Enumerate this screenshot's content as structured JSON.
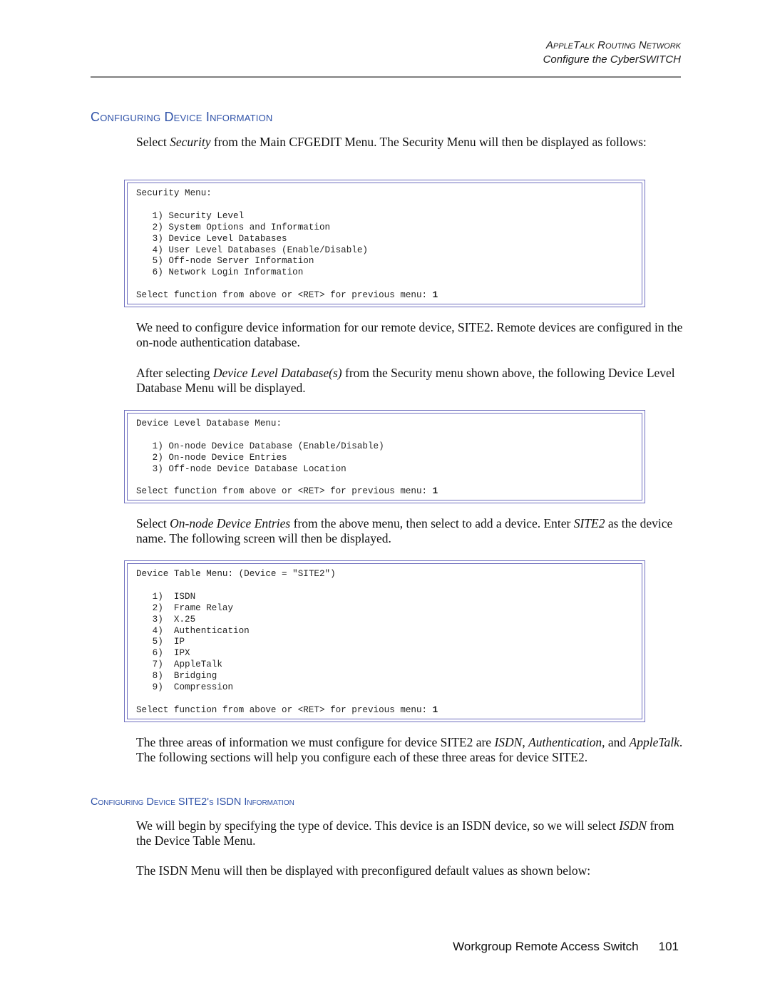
{
  "header": {
    "chapter": "AppleTalk Routing Network",
    "section": "Configure the CyberSWITCH"
  },
  "section_heading": "Configuring Device Information",
  "paragraphs": {
    "p1_pre": "Select ",
    "p1_em": "Security",
    "p1_post": " from the Main CFGEDIT Menu. The Security Menu will then be displayed as follows:",
    "p2": "We need to configure device information for our remote device, SITE2. Remote devices are configured in the on-node authentication database.",
    "p3_pre": "After selecting ",
    "p3_em": "Device Level Database(s)",
    "p3_post": " from the Security menu shown above, the following Device Level Database Menu will be displayed.",
    "p4_pre": "Select ",
    "p4_em1": "On-node Device Entries",
    "p4_mid": " from the above menu, then select to add a device. Enter ",
    "p4_em2": "SITE2",
    "p4_post": " as the device name. The following screen will then be displayed.",
    "p5_pre": "The three areas of information we must configure for device SITE2 are ",
    "p5_em1": "ISDN",
    "p5_sep1": ", ",
    "p5_em2": "Authentication",
    "p5_sep2": ", and ",
    "p5_em3": "AppleTalk",
    "p5_post": ". The following sections will help you configure each of these three areas for device SITE2.",
    "p6_pre": "We will begin by specifying the type of device. This device is an ISDN device, so we will select ",
    "p6_em": "ISDN",
    "p6_post": " from the Device Table Menu.",
    "p7": "The ISDN Menu will then be displayed with preconfigured default values as shown below:"
  },
  "subsection_heading": "Configuring Device SITE2's ISDN Information",
  "screens": {
    "security": {
      "title": "Security Menu:",
      "items": [
        "   1) Security Level",
        "   2) System Options and Information",
        "   3) Device Level Databases",
        "   4) User Level Databases (Enable/Disable)",
        "   5) Off-node Server Information",
        "   6) Network Login Information"
      ],
      "prompt": "Select function from above or <RET> for previous menu: ",
      "input": "1"
    },
    "device_level": {
      "title": "Device Level Database Menu:",
      "items": [
        "   1) On-node Device Database (Enable/Disable)",
        "   2) On-node Device Entries",
        "   3) Off-node Device Database Location"
      ],
      "prompt": "Select function from above or <RET> for previous menu: ",
      "input": "1"
    },
    "device_table": {
      "title": "Device Table Menu: (Device = \"SITE2\")",
      "items": [
        "   1)  ISDN",
        "   2)  Frame Relay",
        "   3)  X.25",
        "   4)  Authentication",
        "   5)  IP",
        "   6)  IPX",
        "   7)  AppleTalk",
        "   8)  Bridging",
        "   9)  Compression"
      ],
      "prompt": "Select function from above or <RET> for previous menu: ",
      "input": "1"
    }
  },
  "footer": {
    "title": "Workgroup Remote Access Switch",
    "page_number": "101"
  },
  "colors": {
    "heading": "#2f52a8",
    "box_border": "#6f6fbf",
    "rule": "#808080"
  }
}
